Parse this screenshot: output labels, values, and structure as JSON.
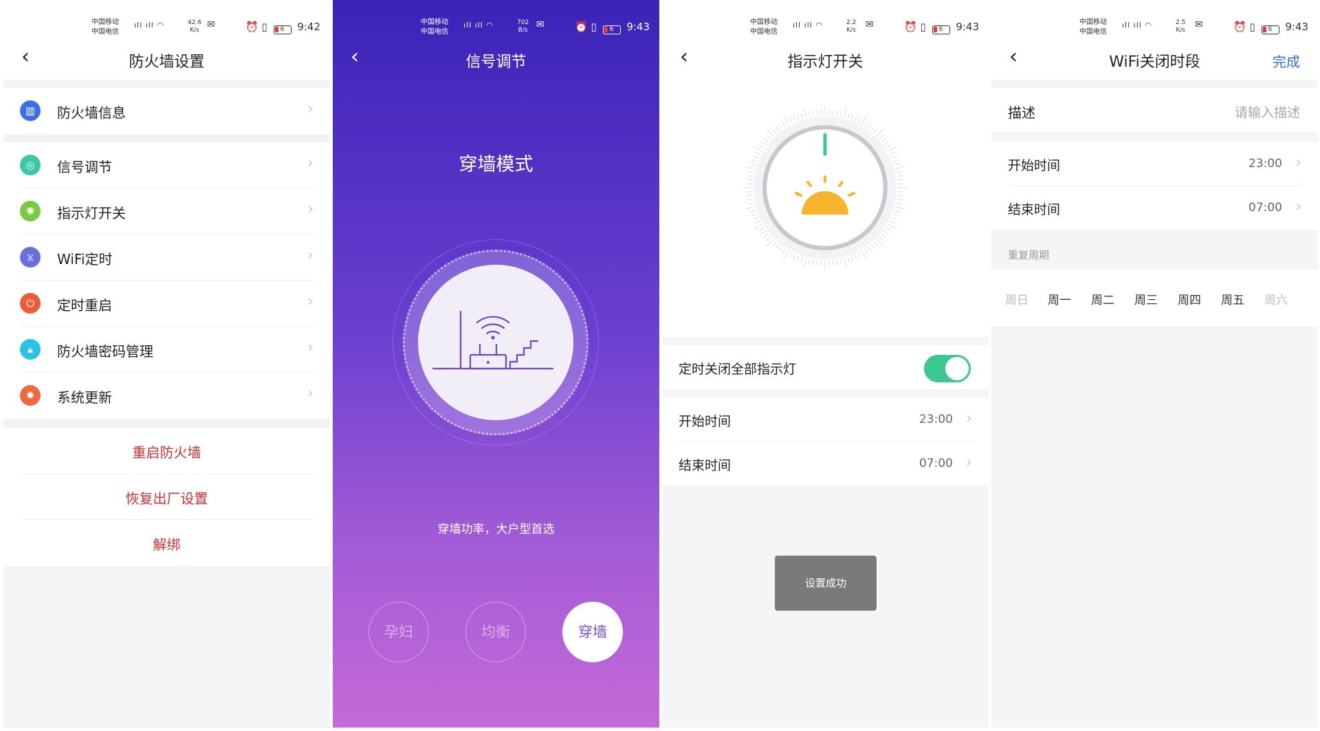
{
  "status_bars": [
    {
      "carrier1": "中国移动",
      "carrier2": "中国电信",
      "speed_value": "42.6",
      "speed_unit": "K/s",
      "battery": "6",
      "time": "9:42"
    },
    {
      "carrier1": "中国移动",
      "carrier2": "中国电信",
      "speed_value": "702",
      "speed_unit": "B/s",
      "battery": "6",
      "time": "9:43"
    },
    {
      "carrier1": "中国移动",
      "carrier2": "中国电信",
      "speed_value": "2.2",
      "speed_unit": "K/s",
      "battery": "6",
      "time": "9:43"
    },
    {
      "carrier1": "中国移动",
      "carrier2": "中国电信",
      "speed_value": "2.5",
      "speed_unit": "K/s",
      "battery": "6",
      "time": "9:43"
    }
  ],
  "screen1": {
    "title": "防火墙设置",
    "items": [
      {
        "label": "防火墙信息",
        "icon": "firewall-icon",
        "color": "#3d6ee8"
      },
      {
        "label": "信号调节",
        "icon": "signal-icon",
        "color": "#3bc9a5"
      },
      {
        "label": "指示灯开关",
        "icon": "light-icon",
        "color": "#7bc843"
      },
      {
        "label": "WiFi定时",
        "icon": "hourglass-icon",
        "color": "#6a6ee0"
      },
      {
        "label": "定时重启",
        "icon": "power-icon",
        "color": "#ee5a3a"
      },
      {
        "label": "防火墙密码管理",
        "icon": "lock-icon",
        "color": "#29c3e8"
      },
      {
        "label": "系统更新",
        "icon": "update-icon",
        "color": "#f06a3d"
      }
    ],
    "actions": [
      "重启防火墙",
      "恢复出厂设置",
      "解绑"
    ]
  },
  "screen2": {
    "title": "信号调节",
    "mode_title": "穿墙模式",
    "description": "穿墙功率，大户型首选",
    "modes": [
      "孕妇",
      "均衡",
      "穿墙"
    ],
    "active_mode": "穿墙"
  },
  "screen3": {
    "title": "指示灯开关",
    "toggle_label": "定时关闭全部指示灯",
    "toggle_on": true,
    "start_label": "开始时间",
    "start_value": "23:00",
    "end_label": "结束时间",
    "end_value": "07:00",
    "toast": "设置成功",
    "accent": "#3cc78f"
  },
  "screen4": {
    "title": "WiFi关闭时段",
    "done": "完成",
    "desc_label": "描述",
    "desc_placeholder": "请输入描述",
    "start_label": "开始时间",
    "start_value": "23:00",
    "end_label": "结束时间",
    "end_value": "07:00",
    "repeat_header": "重复周期",
    "weekdays": [
      {
        "label": "周日",
        "selected": false
      },
      {
        "label": "周一",
        "selected": true
      },
      {
        "label": "周二",
        "selected": true
      },
      {
        "label": "周三",
        "selected": true
      },
      {
        "label": "周四",
        "selected": true
      },
      {
        "label": "周五",
        "selected": true
      },
      {
        "label": "周六",
        "selected": false
      }
    ]
  }
}
